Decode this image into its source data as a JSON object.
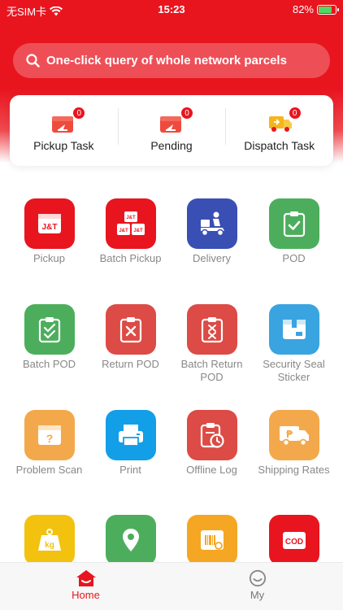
{
  "status_bar": {
    "carrier": "无SIM卡",
    "time": "15:23",
    "battery": "82%",
    "battery_level": 0.82
  },
  "search": {
    "placeholder": "One-click query of whole network parcels"
  },
  "tasks": [
    {
      "label": "Pickup Task",
      "count": "0",
      "icon": "parcel-box-icon"
    },
    {
      "label": "Pending",
      "count": "0",
      "icon": "parcel-box-icon"
    },
    {
      "label": "Dispatch Task",
      "count": "0",
      "icon": "delivery-truck-icon"
    }
  ],
  "menu": {
    "pickup": {
      "label": "Pickup",
      "icon_text": "J&T"
    },
    "batch_pickup": {
      "label": "Batch Pickup",
      "icon_text": "J&T"
    },
    "delivery": {
      "label": "Delivery"
    },
    "pod": {
      "label": "POD"
    },
    "batch_pod": {
      "label": "Batch POD"
    },
    "return_pod": {
      "label": "Return POD"
    },
    "batch_return_pod": {
      "label": "Batch Return POD"
    },
    "security_seal": {
      "label": "Security Seal Sticker"
    },
    "problem_scan": {
      "label": "Problem Scan"
    },
    "print": {
      "label": "Print"
    },
    "offline_log": {
      "label": "Offline Log"
    },
    "shipping_rates": {
      "label": "Shipping Rates"
    },
    "weight": {
      "icon_text": "kg"
    },
    "cod": {
      "icon_text": "COD"
    }
  },
  "colors": {
    "brand_red": "#e8151f",
    "blue": "#3a4fb3",
    "green": "#4cae5c",
    "coral": "#dc4b45",
    "sky": "#3aa4e0",
    "orange": "#f3a94b",
    "cyan": "#139ee8",
    "yellow": "#f2c20f",
    "amber": "#f5a623"
  },
  "tabbar": {
    "home": "Home",
    "my": "My"
  }
}
